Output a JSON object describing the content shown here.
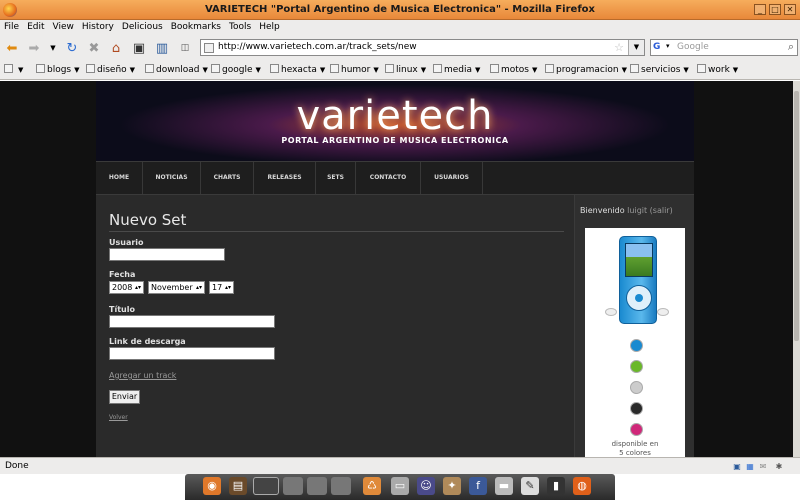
{
  "window": {
    "title": "VARIETECH \"Portal Argentino de Musica Electronica\" - Mozilla Firefox",
    "controls": [
      "_",
      "□",
      "✕"
    ]
  },
  "menubar": {
    "items": [
      "File",
      "Edit",
      "View",
      "History",
      "Delicious",
      "Bookmarks",
      "Tools",
      "Help"
    ]
  },
  "navbar": {
    "url": "http://www.varietech.com.ar/track_sets/new",
    "search_placeholder": "Google",
    "search_engine_letter": "G"
  },
  "bookmarks": {
    "items": [
      "blogs",
      "diseño",
      "download",
      "google",
      "hexacta",
      "humor",
      "linux",
      "media",
      "motos",
      "programacion",
      "servicios",
      "work"
    ]
  },
  "site": {
    "logo": "varietech",
    "tagline": "PORTAL ARGENTINO DE MUSICA ELECTRONICA",
    "nav": [
      "HOME",
      "NOTICIAS",
      "CHARTS",
      "RELEASES",
      "SETS",
      "CONTACTO",
      "USUARIOS"
    ]
  },
  "form": {
    "heading": "Nuevo Set",
    "usuario_label": "Usuario",
    "usuario_value": "",
    "fecha_label": "Fecha",
    "year": "2008",
    "month": "November",
    "day": "17",
    "titulo_label": "Título",
    "titulo_value": "",
    "link_label": "Link de descarga",
    "link_value": "",
    "add_track": "Agregar un track",
    "submit": "Enviar",
    "back": "Volver"
  },
  "sidebar": {
    "welcome_prefix": "Bienvenido",
    "username": "luigit",
    "logout": "(salir)",
    "ad_caption_1": "disponible en",
    "ad_caption_2": "5 colores",
    "swatch_colors": [
      "#1a8ad0",
      "#6ab82a",
      "#cccccc",
      "#2a2a2a",
      "#d0287a"
    ]
  },
  "statusbar": {
    "status": "Done"
  }
}
